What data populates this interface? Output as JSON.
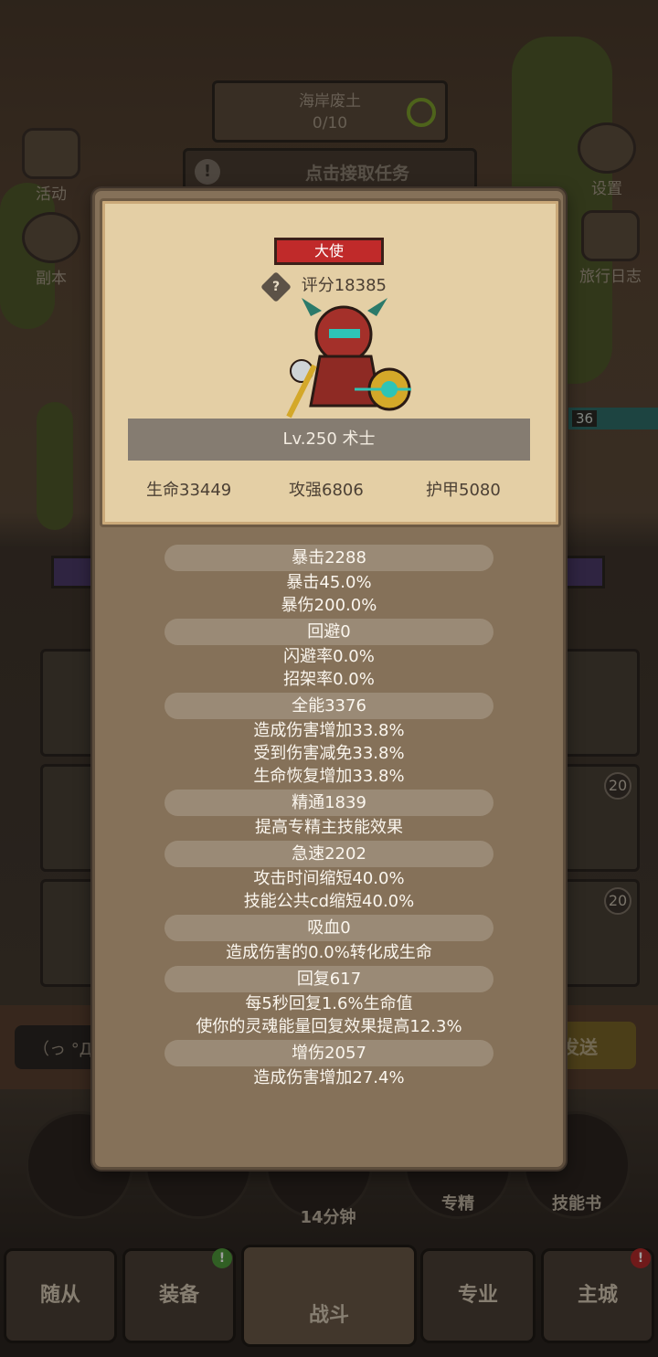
{
  "background": {
    "quest": {
      "title": "海岸废土",
      "progress": "0/10"
    },
    "task_button": "点击接取任务",
    "left_buttons": [
      {
        "label": "活动"
      },
      {
        "label": "副本"
      }
    ],
    "right_buttons": [
      {
        "label": "设置"
      },
      {
        "label": "旅行日志"
      }
    ],
    "level_badge": "36",
    "slot_badges": [
      "20",
      "20"
    ],
    "chat_input": "（っ °Д °",
    "send_label": "发送",
    "bottom_items": [
      {
        "label": "专精"
      },
      {
        "label": "技能书"
      }
    ],
    "timer": "14分钟",
    "nav": [
      "随从",
      "装备",
      "战斗",
      "专业",
      "主城"
    ],
    "nav_badge_equip": "!",
    "nav_badge_city": "!"
  },
  "modal": {
    "title_badge": "大使",
    "help_icon": "?",
    "score": "评分18385",
    "level_class": "Lv.250 术士",
    "base_stats": {
      "hp": "生命33449",
      "atk": "攻强6806",
      "armor": "护甲5080"
    },
    "stat_groups": [
      {
        "head": "暴击2288",
        "lines": [
          "暴击45.0%",
          "暴伤200.0%"
        ]
      },
      {
        "head": "回避0",
        "lines": [
          "闪避率0.0%",
          "招架率0.0%"
        ]
      },
      {
        "head": "全能3376",
        "lines": [
          "造成伤害增加33.8%",
          "受到伤害减免33.8%",
          "生命恢复增加33.8%"
        ]
      },
      {
        "head": "精通1839",
        "lines": [
          "提高专精主技能效果"
        ]
      },
      {
        "head": "急速2202",
        "lines": [
          "攻击时间缩短40.0%",
          "技能公共cd缩短40.0%"
        ]
      },
      {
        "head": "吸血0",
        "lines": [
          "造成伤害的0.0%转化成生命"
        ]
      },
      {
        "head": "回复617",
        "lines": [
          "每5秒回复1.6%生命值",
          "使你的灵魂能量回复效果提高12.3%"
        ]
      },
      {
        "head": "增伤2057",
        "lines": [
          "造成伤害增加27.4%"
        ]
      }
    ]
  },
  "colors": {
    "title_badge": "#c02a2a",
    "card": "#e4cfa5",
    "panel": "#857159"
  }
}
